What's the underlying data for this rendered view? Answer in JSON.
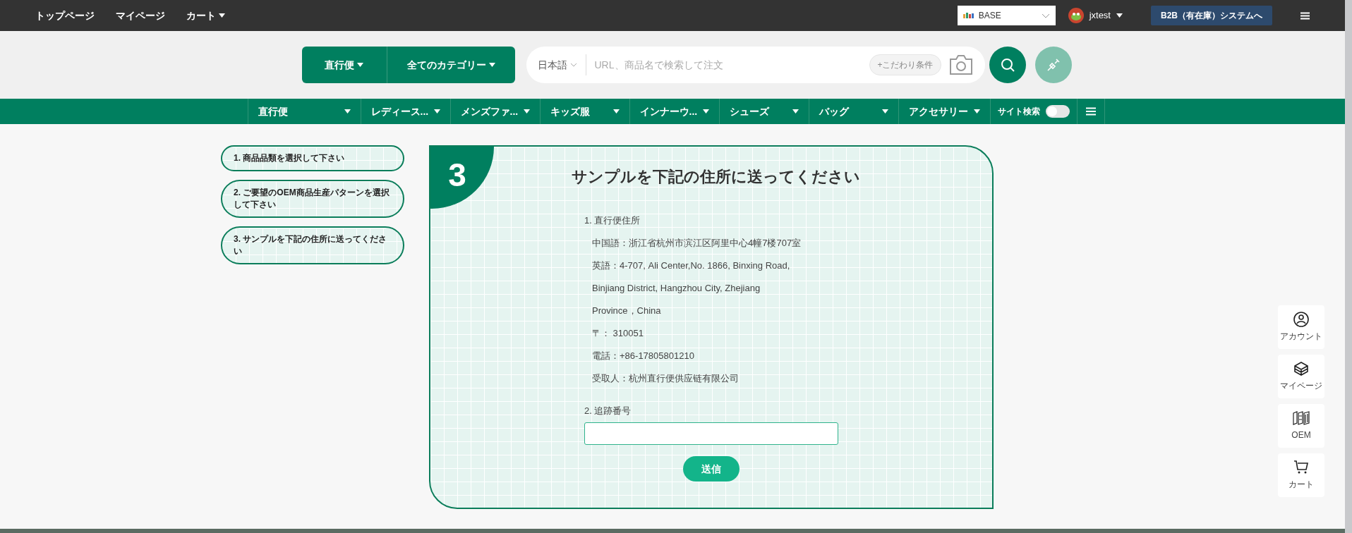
{
  "top_bar": {
    "links": [
      {
        "label": "トップページ",
        "dropdown": false
      },
      {
        "label": "マイページ",
        "dropdown": false
      },
      {
        "label": "カート",
        "dropdown": true
      }
    ],
    "store_select": {
      "value": "BASE"
    },
    "user": {
      "name": "jxtest"
    },
    "b2b_button": "B2B（有在庫）システムへ"
  },
  "search_bar": {
    "mode_buttons": [
      "直行便",
      "全てのカテゴリー"
    ],
    "language": "日本語",
    "placeholder": "URL、商品名で検索して注文",
    "filter_button": "+こだわり条件"
  },
  "category_nav": {
    "items": [
      "直行便",
      "レディース...",
      "メンズファ...",
      "キッズ服",
      "インナーウ...",
      "シューズ",
      "バッグ",
      "アクセサリー"
    ],
    "site_search": {
      "label": "サイト検索",
      "on": false
    }
  },
  "steps": [
    "1. 商品品類を選択して下さい",
    "2. ご要望のOEM商品生産パターンを選択して下さい",
    "3. サンプルを下記の住所に送ってください"
  ],
  "card": {
    "number": "3",
    "title": "サンプルを下記の住所に送ってください",
    "address_heading": "1. 直行便住所",
    "address_lines": [
      "中国語：浙江省杭州市滨江区阿里中心4幢7楼707室",
      "英語：4-707, Ali Center,No. 1866, Binxing Road,",
      "Binjiang District, Hangzhou City, Zhejiang",
      "Province，China",
      "〒： 310051",
      "電話：+86-17805801210",
      "受取人：杭州直行便供应链有限公司"
    ],
    "tracking_heading": "2. 追跡番号",
    "submit": "送信"
  },
  "side_buttons": [
    {
      "kind": "account",
      "label": "アカウント"
    },
    {
      "kind": "mypage",
      "label": "マイページ"
    },
    {
      "kind": "oem",
      "label": "OEM"
    },
    {
      "kind": "cart",
      "label": "カート"
    }
  ]
}
